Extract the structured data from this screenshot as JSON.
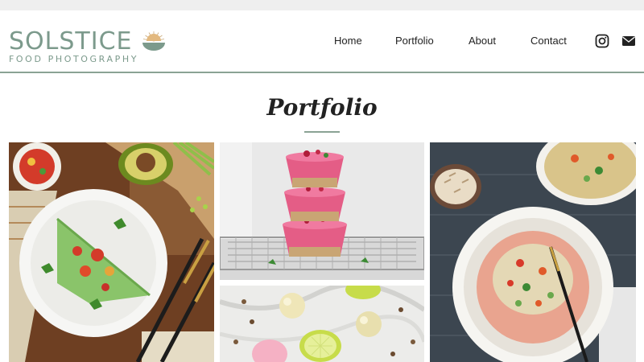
{
  "brand": {
    "name": "SOLSTICE",
    "tagline": "FOOD PHOTOGRAPHY",
    "color": "#7c9a8c"
  },
  "nav": {
    "items": [
      {
        "label": "Home"
      },
      {
        "label": "Portfolio"
      },
      {
        "label": "About"
      },
      {
        "label": "Contact"
      }
    ]
  },
  "social": [
    {
      "icon": "instagram-icon"
    },
    {
      "icon": "mail-icon"
    }
  ],
  "main": {
    "title": "Portfolio"
  },
  "gallery": [
    {
      "subject": "green crepe with salsa and avocado"
    },
    {
      "subject": "stacked pink raspberry cheesecake cups"
    },
    {
      "subject": "white chocolate truffles with lime"
    },
    {
      "subject": "orzo salad with almonds"
    }
  ],
  "colors": {
    "accent": "#8aa394",
    "text": "#222222",
    "topstrip": "#efefef"
  }
}
